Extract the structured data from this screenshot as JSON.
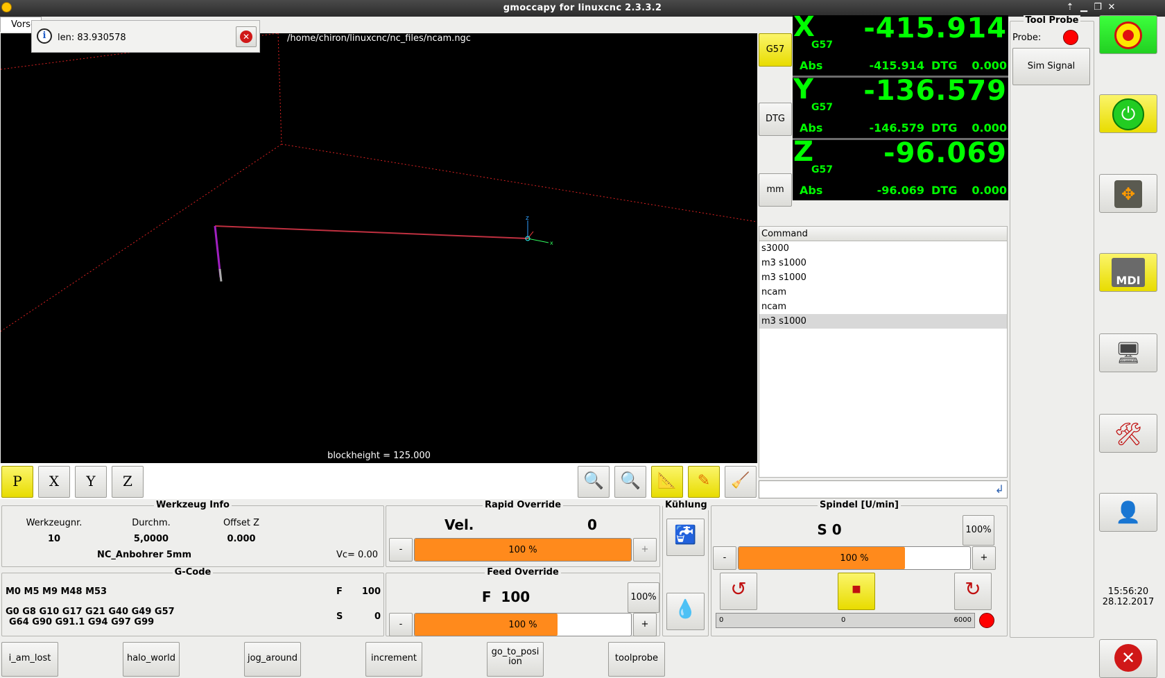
{
  "window": {
    "title": "gmoccapy for linuxcnc  2.3.3.2"
  },
  "tab": {
    "label": "Vorschau"
  },
  "info": {
    "text": "len: 83.930578"
  },
  "preview": {
    "filename": "/home/chiron/linuxcnc/nc_files/ncam.ngc",
    "blockheight": "blockheight = 125.000"
  },
  "dro_side_buttons": {
    "g57": "G57",
    "dtg": "DTG",
    "mm": "mm"
  },
  "axes": [
    {
      "axis": "X",
      "coord": "G57",
      "value": "-415.914",
      "abs_label": "Abs",
      "abs": "-415.914",
      "dtg_label": "DTG",
      "dtg": "0.000"
    },
    {
      "axis": "Y",
      "coord": "G57",
      "value": "-136.579",
      "abs_label": "Abs",
      "abs": "-146.579",
      "dtg_label": "DTG",
      "dtg": "0.000"
    },
    {
      "axis": "Z",
      "coord": "G57",
      "value": "-96.069",
      "abs_label": "Abs",
      "abs": "-96.069",
      "dtg_label": "DTG",
      "dtg": "0.000"
    }
  ],
  "tool_probe": {
    "title": "Tool Probe",
    "probe_label": "Probe:",
    "probe_color": "#ff0000",
    "sim_signal": "Sim Signal"
  },
  "command_history": {
    "header": "Command",
    "items": [
      "s3000",
      "m3 s1000",
      "m3 s1000",
      "ncam",
      "ncam",
      "m3 s1000"
    ],
    "selected_index": 5
  },
  "tool_info": {
    "title": "Werkzeug Info",
    "col1": "Werkzeugnr.",
    "col2": "Durchm.",
    "col3": "Offset Z",
    "tool_nr": "10",
    "diameter": "5,0000",
    "offset_z": "0.000",
    "name": "NC_Anbohrer 5mm",
    "vc": "Vc= 0.00"
  },
  "gcode": {
    "title": "G-Code",
    "mcodes": "M0 M5 M9 M48 M53",
    "f_label": "F",
    "f_value": "100",
    "gcodes_1": "G0 G8 G10 G17 G21 G40 G49 G57",
    "gcodes_2": "G64 G90 G91.1 G94 G97 G99",
    "s_label": "S",
    "s_value": "0"
  },
  "rapid_override": {
    "title": "Rapid Override",
    "vel_label": "Vel.",
    "vel_value": "0",
    "bar_text": "100 %",
    "fill_fraction": 1.0,
    "minus": "-",
    "plus": "+"
  },
  "feed_override": {
    "title": "Feed Override",
    "f_text": "F  100",
    "reset": "100%",
    "bar_text": "100 %",
    "fill_fraction": 0.66,
    "minus": "-",
    "plus": "+"
  },
  "coolant": {
    "title": "Kühlung"
  },
  "spindle": {
    "title": "Spindel [U/min]",
    "s_text": "S 0",
    "reset": "100%",
    "bar_text": "100 %",
    "fill_fraction": 0.72,
    "minus": "-",
    "plus": "+",
    "scale_min": "0",
    "scale_mid": "0",
    "scale_max": "6000",
    "status_color": "#ff0000"
  },
  "clock": {
    "time": "15:56:20",
    "date": "28.12.2017"
  },
  "sidebar": {
    "mdi": "MDI"
  },
  "bottom_buttons": [
    "i_am_lost",
    "halo_world",
    "jog_around",
    "increment",
    "go_to_posi\nion",
    "toolprobe"
  ],
  "view_buttons": {
    "p": "P",
    "x": "X",
    "y": "Y",
    "z": "Z"
  },
  "colors": {
    "accent_yellow": "#f2e700",
    "override_orange": "#ff8a1c",
    "dro_green": "#00ff00"
  }
}
